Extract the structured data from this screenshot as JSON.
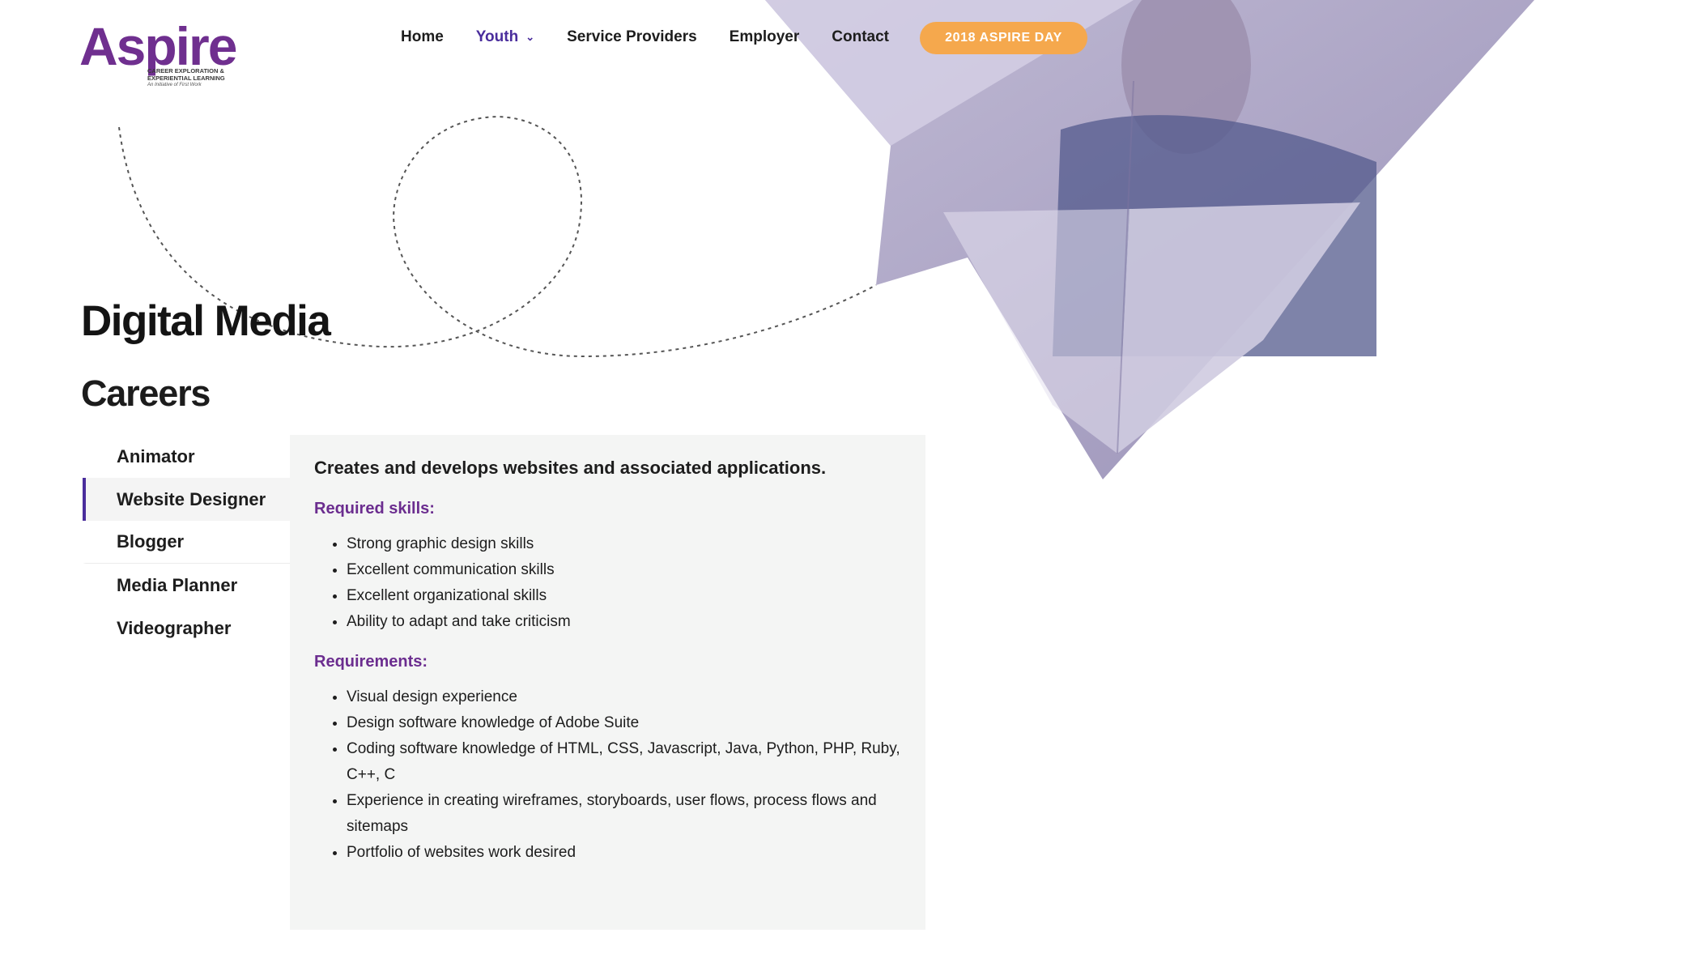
{
  "brand": {
    "name": "Aspire",
    "tagline": "CAREER EXPLORATION & EXPERIENTIAL LEARNING",
    "sub_tagline": "An Initiative of First Work",
    "color": "#6f2f8f"
  },
  "nav": {
    "items": [
      {
        "label": "Home"
      },
      {
        "label": "Youth",
        "active": true,
        "has_dropdown": true
      },
      {
        "label": "Service Providers"
      },
      {
        "label": "Employer"
      },
      {
        "label": "Contact"
      }
    ],
    "cta_label": "2018 ASPIRE DAY",
    "cta_color": "#f5a84d",
    "active_color": "#4a2d9c"
  },
  "page": {
    "title": "Digital Media",
    "subtitle": "Careers"
  },
  "careers": {
    "tabs": [
      {
        "label": "Animator"
      },
      {
        "label": "Website Designer",
        "selected": true
      },
      {
        "label": "Blogger"
      },
      {
        "label": "Media Planner"
      },
      {
        "label": "Videographer"
      }
    ],
    "detail": {
      "description": "Creates and develops websites and associated applications.",
      "skills_heading": "Required skills:",
      "skills": [
        "Strong graphic design skills",
        "Excellent communication skills",
        "Excellent organizational skills",
        "Ability to adapt and take criticism"
      ],
      "requirements_heading": "Requirements:",
      "requirements": [
        "Visual design experience",
        "Design software knowledge of Adobe Suite",
        "Coding software knowledge of HTML, CSS, Javascript, Java, Python, PHP, Ruby, C++, C",
        "Experience in creating wireframes, storyboards, user flows, process flows and sitemaps",
        "Portfolio of websites work desired"
      ]
    },
    "accent_color": "#4a2d9c"
  }
}
